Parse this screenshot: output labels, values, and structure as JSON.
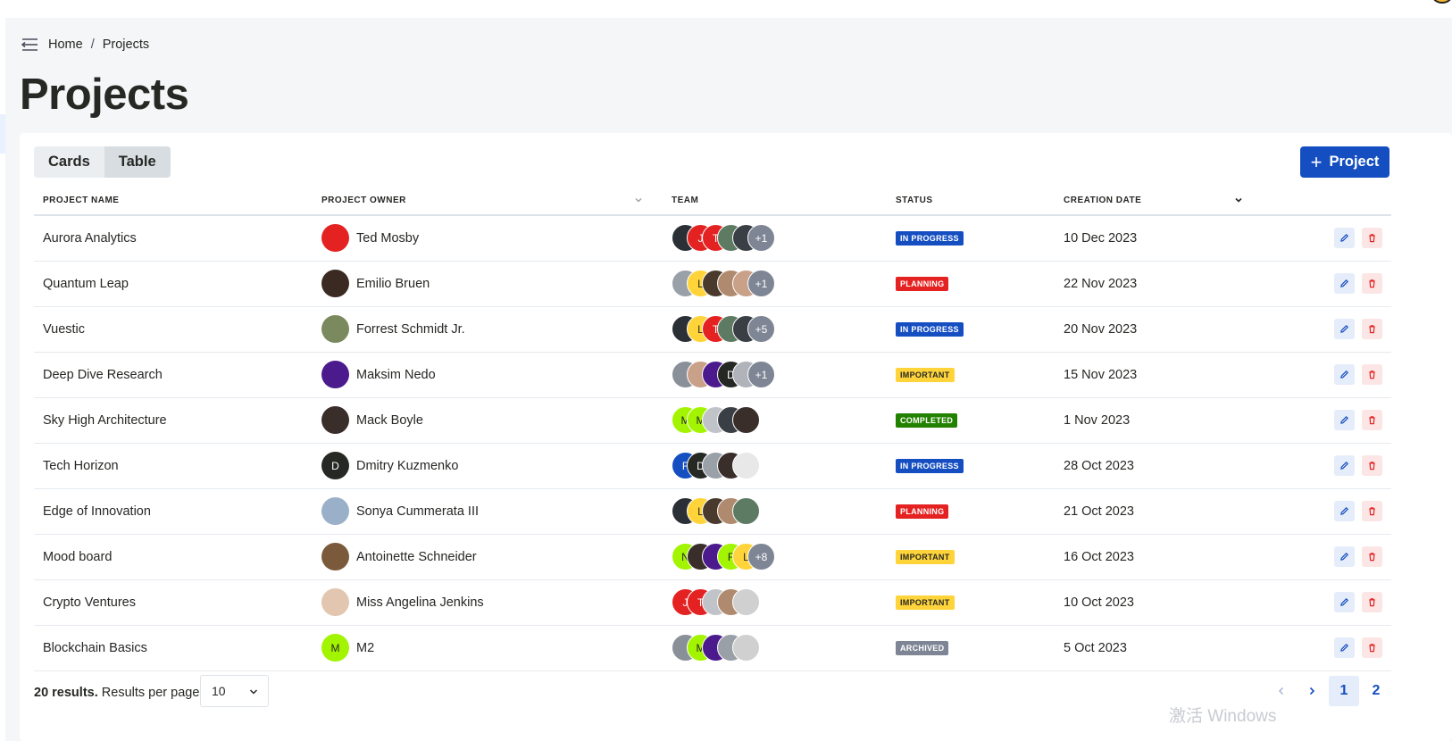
{
  "breadcrumb": {
    "home": "Home",
    "separator": "/",
    "current": "Projects"
  },
  "page_title": "Projects",
  "view_toggle": {
    "cards": "Cards",
    "table": "Table",
    "active": "table"
  },
  "add_button": {
    "icon": "+",
    "label": "Project"
  },
  "table": {
    "headers": {
      "name": "PROJECT NAME",
      "owner": "PROJECT OWNER",
      "team": "TEAM",
      "status": "STATUS",
      "date": "CREATION DATE"
    },
    "rows": [
      {
        "name": "Aurora Analytics",
        "owner": {
          "name": "Ted Mosby",
          "avatar": {
            "text": "",
            "color": "#e42222"
          }
        },
        "team": [
          {
            "text": "",
            "color": "#2b2f36"
          },
          {
            "text": "J",
            "color": "#e42222"
          },
          {
            "text": "T",
            "color": "#e42222"
          },
          {
            "text": "",
            "color": "#5d7a63"
          },
          {
            "text": "",
            "color": "#3a3f46"
          }
        ],
        "team_more": "+1",
        "status": {
          "label": "IN PROGRESS",
          "bg": "#154ec1",
          "fg": "#ffffff"
        },
        "date": "10 Dec 2023"
      },
      {
        "name": "Quantum Leap",
        "owner": {
          "name": "Emilio Bruen",
          "avatar": {
            "text": "",
            "color": "#3a2a22"
          }
        },
        "team": [
          {
            "text": "",
            "color": "#9aa0a8"
          },
          {
            "text": "L",
            "color": "#ffd43a"
          },
          {
            "text": "",
            "color": "#4a3a2e"
          },
          {
            "text": "",
            "color": "#b08a6e"
          },
          {
            "text": "",
            "color": "#c9a088"
          }
        ],
        "team_more": "+1",
        "status": {
          "label": "PLANNING",
          "bg": "#e42222",
          "fg": "#ffffff"
        },
        "date": "22 Nov 2023"
      },
      {
        "name": "Vuestic",
        "owner": {
          "name": "Forrest Schmidt Jr.",
          "avatar": {
            "text": "",
            "color": "#7a8a5e"
          }
        },
        "team": [
          {
            "text": "",
            "color": "#2b2f36"
          },
          {
            "text": "L",
            "color": "#ffd43a"
          },
          {
            "text": "T",
            "color": "#e42222"
          },
          {
            "text": "",
            "color": "#5d7a63"
          },
          {
            "text": "",
            "color": "#3a3f46"
          }
        ],
        "team_more": "+5",
        "status": {
          "label": "IN PROGRESS",
          "bg": "#154ec1",
          "fg": "#ffffff"
        },
        "date": "20 Nov 2023"
      },
      {
        "name": "Deep Dive Research",
        "owner": {
          "name": "Maksim Nedo",
          "avatar": {
            "text": "",
            "color": "#4b1a8c"
          }
        },
        "team": [
          {
            "text": "",
            "color": "#8a9098"
          },
          {
            "text": "",
            "color": "#c9a088"
          },
          {
            "text": "",
            "color": "#4b1a8c"
          },
          {
            "text": "D",
            "color": "#262824"
          },
          {
            "text": "",
            "color": "#b0b4ba"
          }
        ],
        "team_more": "+1",
        "status": {
          "label": "IMPORTANT",
          "bg": "#ffd43a",
          "fg": "#262824"
        },
        "date": "15 Nov 2023"
      },
      {
        "name": "Sky High Architecture",
        "owner": {
          "name": "Mack Boyle",
          "avatar": {
            "text": "",
            "color": "#3a2e2a"
          }
        },
        "team": [
          {
            "text": "M",
            "color": "#a3f400"
          },
          {
            "text": "M",
            "color": "#a3f400"
          },
          {
            "text": "",
            "color": "#c0c4c8"
          },
          {
            "text": "",
            "color": "#3a3f46"
          },
          {
            "text": "",
            "color": "#3a2e2a"
          }
        ],
        "team_more": "",
        "status": {
          "label": "COMPLETED",
          "bg": "#228200",
          "fg": "#ffffff"
        },
        "date": "1 Nov 2023"
      },
      {
        "name": "Tech Horizon",
        "owner": {
          "name": "Dmitry Kuzmenko",
          "avatar": {
            "text": "D",
            "color": "#262824"
          }
        },
        "team": [
          {
            "text": "F",
            "color": "#154ec1"
          },
          {
            "text": "D",
            "color": "#262824"
          },
          {
            "text": "",
            "color": "#9aa0a8"
          },
          {
            "text": "",
            "color": "#3a2e2a"
          },
          {
            "text": "",
            "color": "#e8e8e8"
          }
        ],
        "team_more": "",
        "status": {
          "label": "IN PROGRESS",
          "bg": "#154ec1",
          "fg": "#ffffff"
        },
        "date": "28 Oct 2023"
      },
      {
        "name": "Edge of Innovation",
        "owner": {
          "name": "Sonya Cummerata III",
          "avatar": {
            "text": "",
            "color": "#9ab0c8"
          }
        },
        "team": [
          {
            "text": "",
            "color": "#2b2f36"
          },
          {
            "text": "L",
            "color": "#ffd43a"
          },
          {
            "text": "",
            "color": "#4a3a2e"
          },
          {
            "text": "",
            "color": "#b08a6e"
          },
          {
            "text": "",
            "color": "#5d7a63"
          }
        ],
        "team_more": "",
        "status": {
          "label": "PLANNING",
          "bg": "#e42222",
          "fg": "#ffffff"
        },
        "date": "21 Oct 2023"
      },
      {
        "name": "Mood board",
        "owner": {
          "name": "Antoinette Schneider",
          "avatar": {
            "text": "",
            "color": "#7a5a3a"
          }
        },
        "team": [
          {
            "text": "N",
            "color": "#a3f400"
          },
          {
            "text": "",
            "color": "#3a2e2a"
          },
          {
            "text": "",
            "color": "#4b1a8c"
          },
          {
            "text": "F",
            "color": "#a3f400"
          },
          {
            "text": "L",
            "color": "#ffd43a"
          }
        ],
        "team_more": "+8",
        "status": {
          "label": "IMPORTANT",
          "bg": "#ffd43a",
          "fg": "#262824"
        },
        "date": "16 Oct 2023"
      },
      {
        "name": "Crypto Ventures",
        "owner": {
          "name": "Miss Angelina Jenkins",
          "avatar": {
            "text": "",
            "color": "#e2c6b0"
          }
        },
        "team": [
          {
            "text": "J",
            "color": "#e42222"
          },
          {
            "text": "T",
            "color": "#e42222"
          },
          {
            "text": "",
            "color": "#c0c4c8"
          },
          {
            "text": "",
            "color": "#b08a6e"
          },
          {
            "text": "",
            "color": "#d0d0d0"
          }
        ],
        "team_more": "",
        "status": {
          "label": "IMPORTANT",
          "bg": "#ffd43a",
          "fg": "#262824"
        },
        "date": "10 Oct 2023"
      },
      {
        "name": "Blockchain Basics",
        "owner": {
          "name": "M2",
          "avatar": {
            "text": "M",
            "color": "#a3f400"
          }
        },
        "team": [
          {
            "text": "",
            "color": "#8a9098"
          },
          {
            "text": "M",
            "color": "#a3f400"
          },
          {
            "text": "",
            "color": "#4b1a8c"
          },
          {
            "text": "",
            "color": "#9aa0a8"
          },
          {
            "text": "",
            "color": "#d0d0d0"
          }
        ],
        "team_more": "",
        "status": {
          "label": "ARCHIVED",
          "bg": "#7e8594",
          "fg": "#ffffff"
        },
        "date": "5 Oct 2023"
      }
    ]
  },
  "footer": {
    "results_count": "20 results.",
    "results_per_page_label": "Results per page",
    "per_page_value": "10",
    "pages": [
      "1",
      "2"
    ],
    "active_page": "1"
  },
  "watermark": "激活 Windows",
  "colors": {
    "primary": "#154ec1",
    "danger": "#e42222",
    "warning": "#ffd43a",
    "success": "#228200",
    "secondary": "#7e8594"
  },
  "icons": {
    "menu": "menu-collapse-icon",
    "add": "plus-icon",
    "edit": "pencil-icon",
    "delete": "trash-icon",
    "sort": "chevron-down-icon",
    "prev": "chevron-left-icon",
    "next": "chevron-right-icon"
  }
}
